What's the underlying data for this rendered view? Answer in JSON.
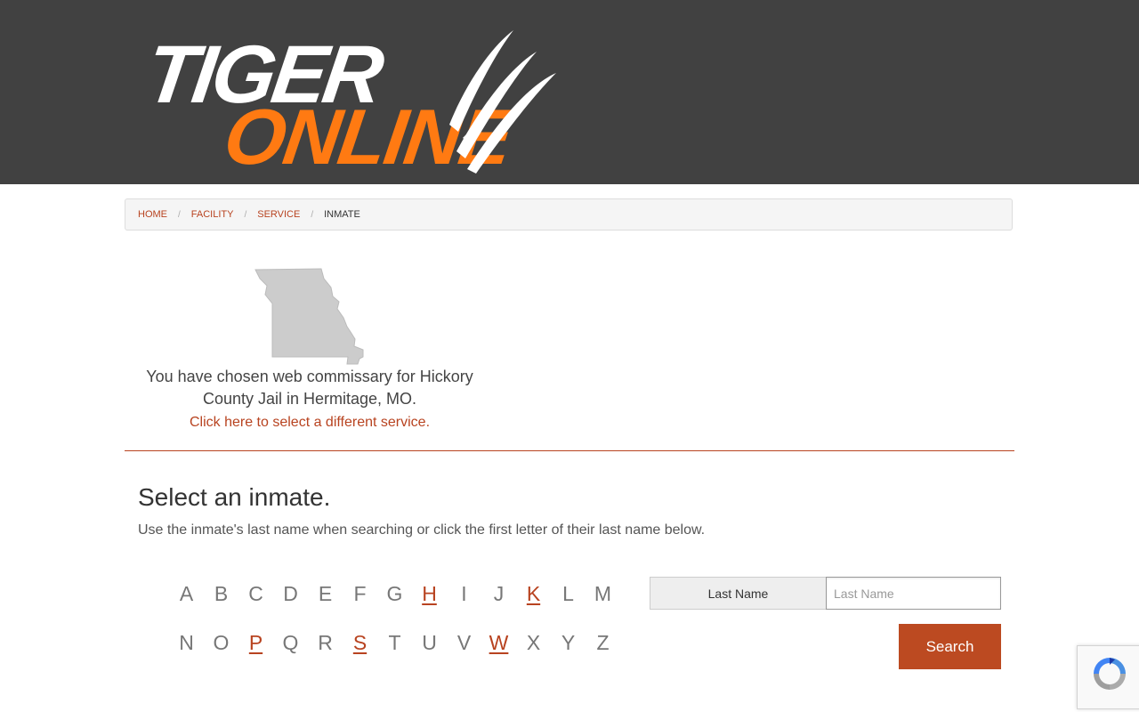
{
  "header": {
    "logo_line1": "TIGER",
    "logo_line2": "ONLINE",
    "logo_colors": {
      "white": "#ffffff",
      "orange": "#ff7a12"
    },
    "background": "#414141"
  },
  "breadcrumb": {
    "items": [
      {
        "label": "HOME"
      },
      {
        "label": "FACILITY"
      },
      {
        "label": "SERVICE"
      },
      {
        "label": "INMATE"
      }
    ],
    "separator": "/"
  },
  "facility": {
    "state_icon": "missouri-state-map",
    "chosen_text": "You have chosen web commissary for Hickory County Jail in Hermitage, MO.",
    "change_link": "Click here to select a different service."
  },
  "inmate_select": {
    "title": "Select an inmate.",
    "instructions": "Use the inmate's last name when searching or click the first letter of their last name below.",
    "letters_row1": [
      {
        "letter": "A",
        "active": false
      },
      {
        "letter": "B",
        "active": false
      },
      {
        "letter": "C",
        "active": false
      },
      {
        "letter": "D",
        "active": false
      },
      {
        "letter": "E",
        "active": false
      },
      {
        "letter": "F",
        "active": false
      },
      {
        "letter": "G",
        "active": false
      },
      {
        "letter": "H",
        "active": true
      },
      {
        "letter": "I",
        "active": false
      },
      {
        "letter": "J",
        "active": false
      },
      {
        "letter": "K",
        "active": true
      },
      {
        "letter": "L",
        "active": false
      },
      {
        "letter": "M",
        "active": false
      }
    ],
    "letters_row2": [
      {
        "letter": "N",
        "active": false
      },
      {
        "letter": "O",
        "active": false
      },
      {
        "letter": "P",
        "active": true
      },
      {
        "letter": "Q",
        "active": false
      },
      {
        "letter": "R",
        "active": false
      },
      {
        "letter": "S",
        "active": true
      },
      {
        "letter": "T",
        "active": false
      },
      {
        "letter": "U",
        "active": false
      },
      {
        "letter": "V",
        "active": false
      },
      {
        "letter": "W",
        "active": true
      },
      {
        "letter": "X",
        "active": false
      },
      {
        "letter": "Y",
        "active": false
      },
      {
        "letter": "Z",
        "active": false
      }
    ],
    "last_name_label": "Last Name",
    "last_name_placeholder": "Last Name",
    "last_name_value": "",
    "search_label": "Search"
  },
  "colors": {
    "accent": "#b84320",
    "button": "#bc4a21",
    "inactive_letter": "#777777"
  },
  "recaptcha_icon": "recaptcha-icon"
}
